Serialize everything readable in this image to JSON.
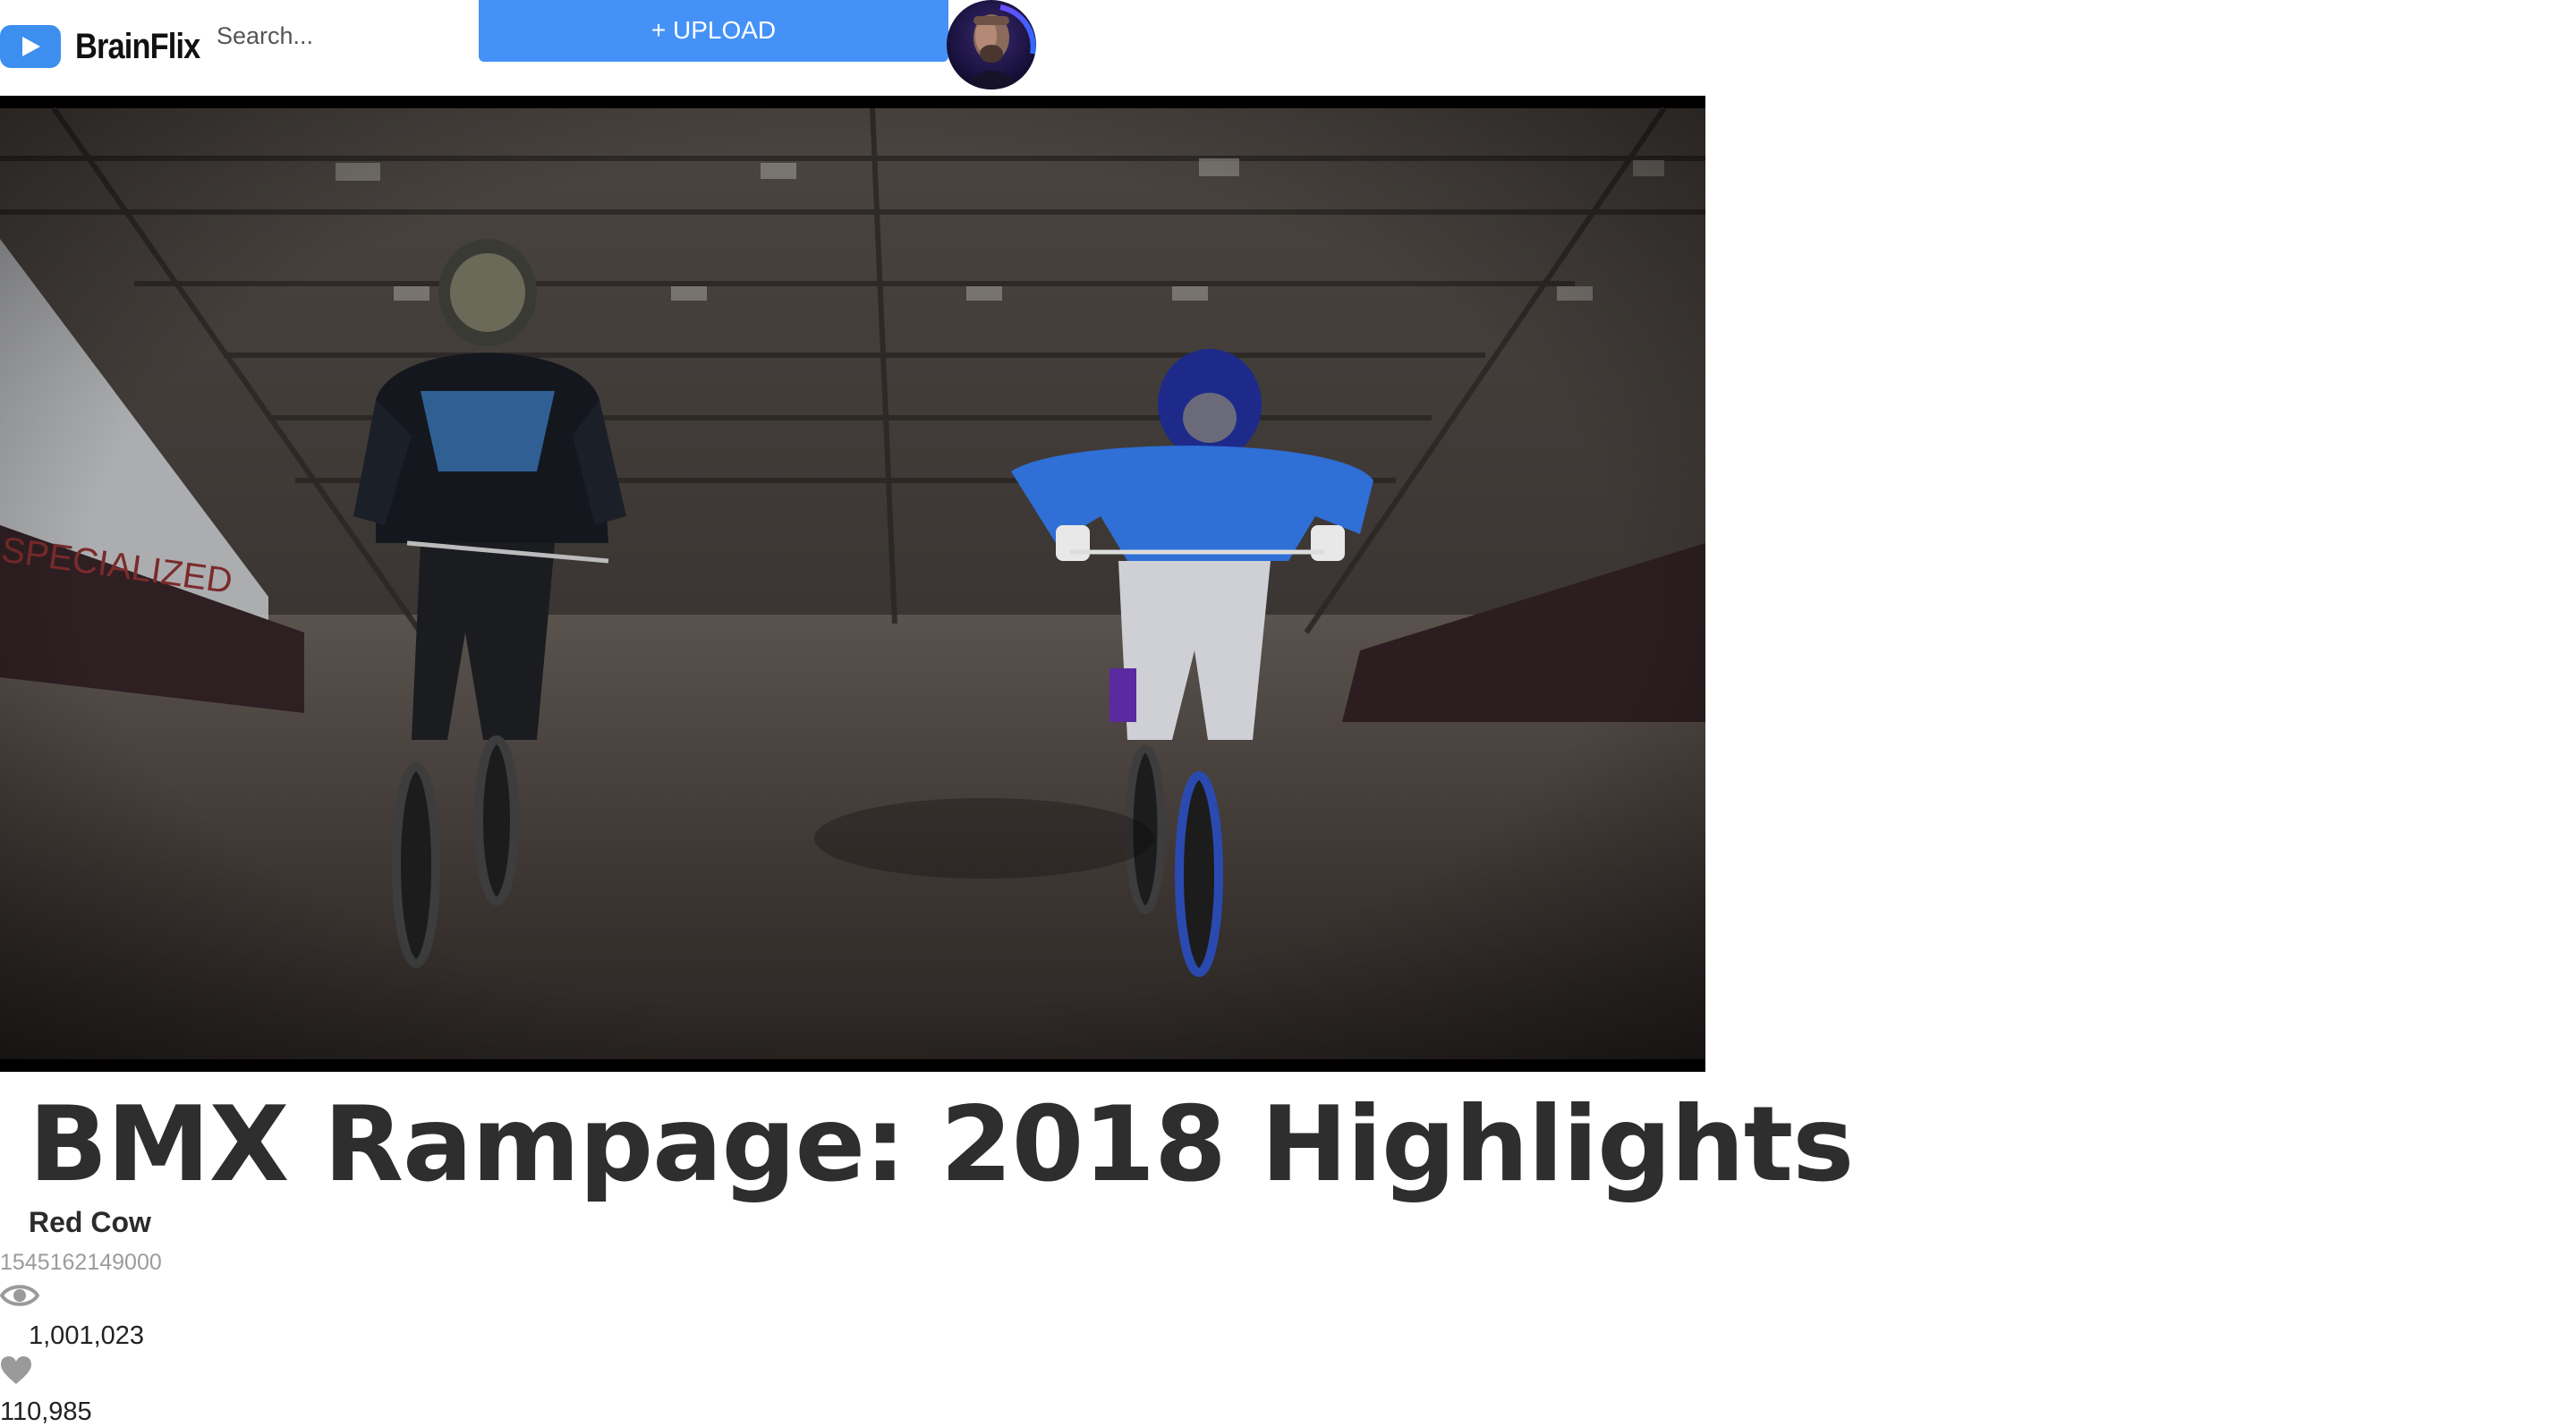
{
  "header": {
    "brand_name": "BrainFlix",
    "search_placeholder": "Search...",
    "upload_label": "+ UPLOAD",
    "brand_color": "#3d8fef",
    "upload_color": "#4492f7"
  },
  "video": {
    "title": "BMX Rampage: 2018 Highlights",
    "channel": "Red Cow",
    "timestamp": "1545162149000",
    "views": "1,001,023",
    "likes": "110,985"
  },
  "icons": {
    "logo": "play-icon",
    "views": "eye-icon",
    "likes": "heart-icon"
  }
}
